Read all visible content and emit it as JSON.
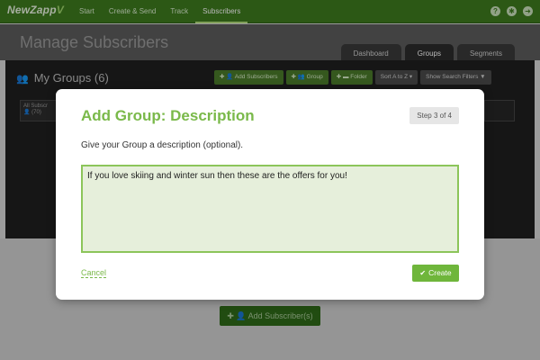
{
  "app": {
    "logo_text": "NewZapp",
    "logo_mark": "V"
  },
  "nav": {
    "items": [
      {
        "label": "Start"
      },
      {
        "label": "Create & Send"
      },
      {
        "label": "Track"
      },
      {
        "label": "Subscribers"
      }
    ],
    "icons": [
      "help-icon",
      "gear-icon",
      "logout-icon"
    ]
  },
  "page": {
    "title": "Manage Subscribers",
    "tabs": [
      {
        "label": "Dashboard"
      },
      {
        "label": "Groups"
      },
      {
        "label": "Segments"
      }
    ]
  },
  "groups_panel": {
    "header": "My Groups (6)",
    "toolbar": {
      "add_subscribers": "Add Subscribers",
      "group": "Group",
      "folder": "Folder",
      "sort": "Sort A to Z",
      "search_filters": "Show Search Filters"
    },
    "card_title": "All Subscr",
    "card_count": "(70)"
  },
  "bottom_button": "Add Subscriber(s)",
  "modal": {
    "title": "Add Group: Description",
    "step": "Step 3 of 4",
    "label": "Give your Group a description (optional).",
    "description_value": "If you love skiing and winter sun then these are the offers for you!",
    "cancel": "Cancel",
    "create": "Create"
  },
  "colors": {
    "brand_green": "#3d7a1e",
    "accent_green": "#7ab94a",
    "button_green": "#6fb63b",
    "textarea_bg": "#e6efdb"
  }
}
